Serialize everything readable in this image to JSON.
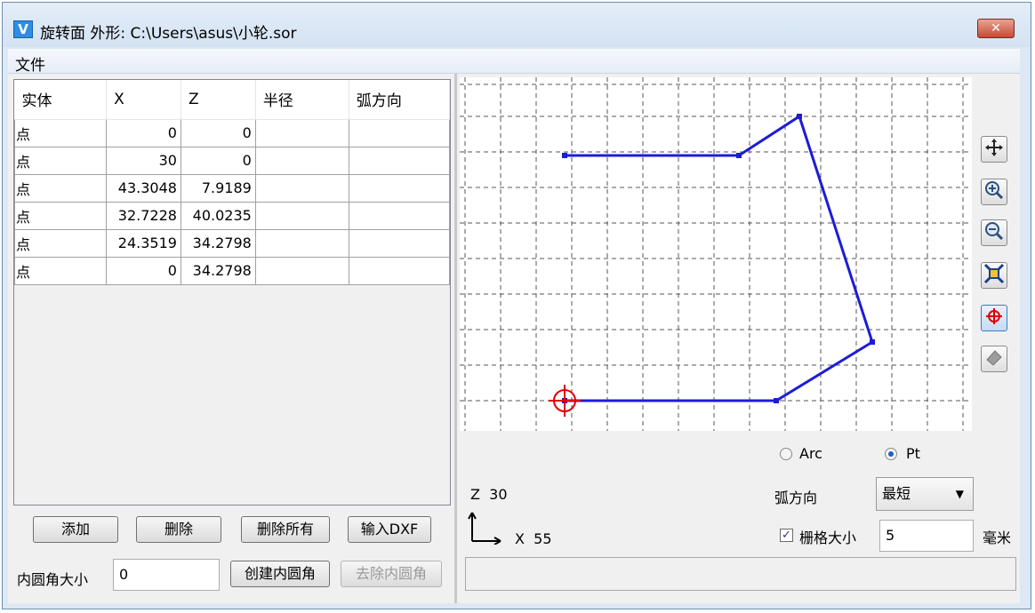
{
  "window": {
    "title": "旋转面 外形: C:\\Users\\asus\\小轮.sor",
    "icon_letter": "V",
    "close_label": "✕"
  },
  "menu": {
    "file": "文件"
  },
  "table": {
    "headers": [
      "实体",
      "X",
      "Z",
      "半径",
      "弧方向"
    ],
    "rows": [
      [
        "点",
        "0",
        "0",
        "",
        ""
      ],
      [
        "点",
        "30",
        "0",
        "",
        ""
      ],
      [
        "点",
        "43.3048",
        "7.9189",
        "",
        ""
      ],
      [
        "点",
        "32.7228",
        "40.0235",
        "",
        ""
      ],
      [
        "点",
        "24.3519",
        "34.2798",
        "",
        ""
      ],
      [
        "点",
        "0",
        "34.2798",
        "",
        ""
      ]
    ]
  },
  "buttons": {
    "add": "添加",
    "delete": "删除",
    "delete_all": "删除所有",
    "import_dxf": "输入DXF",
    "create_fillet": "创建内圆角",
    "remove_fillet": "去除内圆角"
  },
  "fillet": {
    "label": "内圆角大小",
    "value": "0"
  },
  "view": {
    "z_label": "Z",
    "z_value": "30",
    "x_label": "X",
    "x_value": "55",
    "radio_arc": "Arc",
    "radio_pt": "Pt",
    "radio_selected": "Pt",
    "arc_dir_label": "弧方向",
    "arc_dir_value": "最短",
    "grid_label": "栅格大小",
    "grid_checked": true,
    "grid_value": "5",
    "grid_unit": "毫米"
  },
  "icons": [
    "pan-icon",
    "zoom-in-icon",
    "zoom-out-icon",
    "zoom-fit-icon",
    "pick-point-icon",
    "eraser-icon"
  ],
  "colors": {
    "profile": "#1c1cd8",
    "marker": "#e00000",
    "grid": "#555555"
  }
}
